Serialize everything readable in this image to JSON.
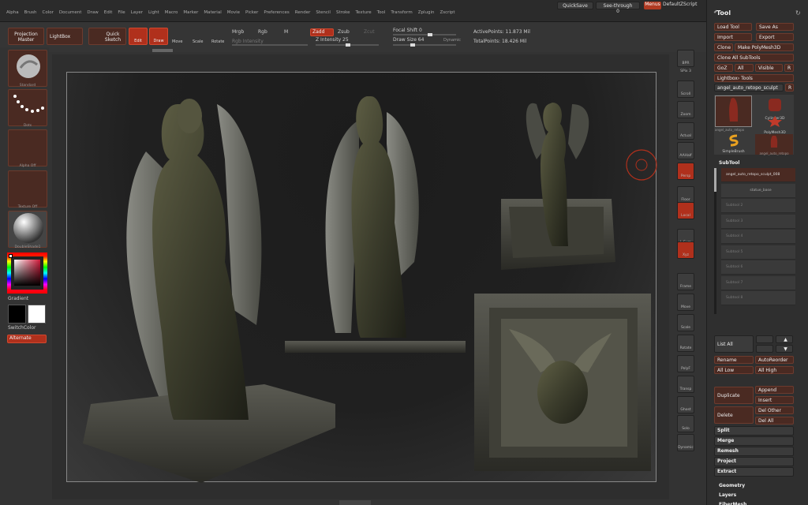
{
  "menubar": {
    "items": [
      "Alpha",
      "Brush",
      "Color",
      "Document",
      "Draw",
      "Edit",
      "File",
      "Layer",
      "Light",
      "Macro",
      "Marker",
      "Material",
      "Movie",
      "Picker",
      "Preferences",
      "Render",
      "Stencil",
      "Stroke",
      "Texture",
      "Tool",
      "Transform",
      "Zplugin",
      "Zscript"
    ],
    "quicksave": "QuickSave",
    "seethrough": "See-through  0",
    "menus": "Menus",
    "default_zscript": "DefaultZScript"
  },
  "shelf": {
    "projection_master": "Projection Master",
    "lightbox": "LightBox",
    "quick_sketch": "Quick Sketch",
    "edit": "Edit",
    "draw": "Draw",
    "move": "Move",
    "scale": "Scale",
    "rotate": "Rotate",
    "mrgb": "Mrgb",
    "rgb": "Rgb",
    "m": "M",
    "rgb_intensity": "Rgb Intensity",
    "zadd": "Zadd",
    "zsub": "Zsub",
    "zcut": "Zcut",
    "z_intensity": "Z Intensity 25",
    "focal_shift": "Focal Shift 0",
    "draw_size": "Draw Size 64",
    "dynamic": "Dynamic",
    "active_points": "ActivePoints: 11.873 Mil",
    "total_points": "TotalPoints: 18.426 Mil"
  },
  "lefttray": {
    "brush": "Standard",
    "stroke": "Dots",
    "alpha": "Alpha Off",
    "texture": "Texture Off",
    "material": "DoubleShade1",
    "gradient": "Gradient",
    "switch_color": "SwitchColor",
    "alternate": "Alternate"
  },
  "righticons": [
    "BPR",
    "SPix 3",
    "Scroll",
    "Zoom",
    "Actual",
    "AAHalf",
    "Persp",
    "Floor",
    "Local",
    "L.Sym",
    "Xyz",
    "Frame",
    "Move",
    "Scale",
    "Rotate",
    "PolyF",
    "Transp",
    "Ghost",
    "Solo",
    "Dynamic"
  ],
  "toolpanel": {
    "title": "Tool",
    "load_tool": "Load Tool",
    "save_as": "Save As",
    "import": "Import",
    "export": "Export",
    "clone": "Clone",
    "make_polymesh": "Make PolyMesh3D",
    "clone_all_subtools": "Clone All SubTools",
    "goz": "GoZ",
    "all": "All",
    "visible": "Visible",
    "r": "R",
    "lightbox_tools": "Lightbox› Tools",
    "current_tool": "angel_auto_retopo_sculpt",
    "tools": [
      {
        "name": "angel_auto_retopo"
      },
      {
        "name": "Cylinder3D"
      },
      {
        "name": "PolyMesh3D"
      },
      {
        "name": "SimpleBrush"
      },
      {
        "name": "angel_auto_retopo"
      }
    ],
    "subtool_header": "SubTool",
    "subtools": [
      "angel_auto_retopo_sculpt_008",
      "statue_base",
      "Subtool 2",
      "Subtool 3",
      "Subtool 4",
      "Subtool 5",
      "Subtool 6",
      "Subtool 7",
      "Subtool 8"
    ],
    "list_all": "List All",
    "rename": "Rename",
    "auto_reorder": "AutoReorder",
    "all_low": "All Low",
    "all_high": "All High",
    "duplicate": "Duplicate",
    "append": "Append",
    "insert": "Insert",
    "delete": "Delete",
    "del_other": "Del Other",
    "del_all": "Del All",
    "split": "Split",
    "merge": "Merge",
    "remesh": "Remesh",
    "project": "Project",
    "extract": "Extract",
    "geometry": "Geometry",
    "layers": "Layers",
    "fibermesh": "FiberMesh"
  },
  "colors": {
    "accent": "#b0301c",
    "button_bg": "#4a2a22",
    "panel_bg": "#2f2f2f"
  }
}
